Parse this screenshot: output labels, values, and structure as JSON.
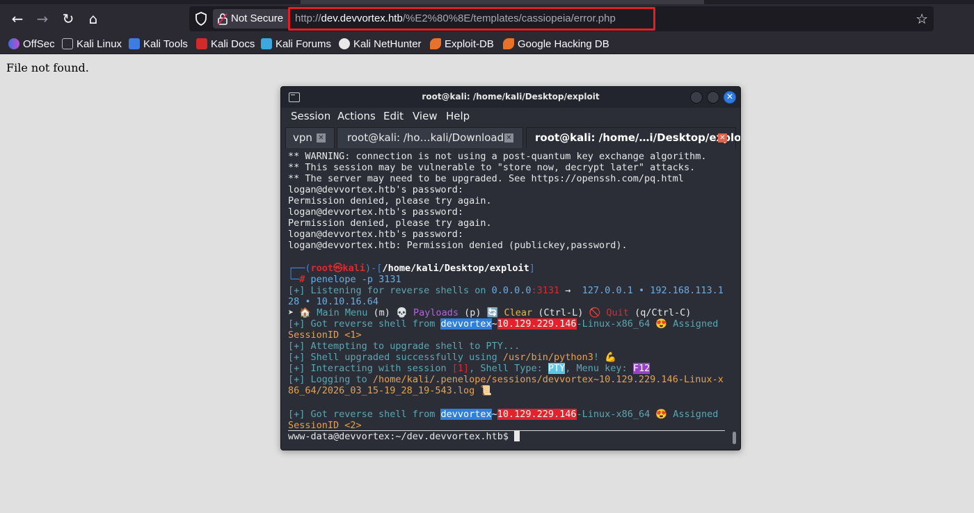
{
  "browser": {
    "not_secure_label": "Not Secure",
    "url_scheme": "http://",
    "url_host": "dev.devvortex.htb",
    "url_path": "/%E2%80%8E/templates/cassiopeia/error.php",
    "highlight_color": "#e41e25"
  },
  "bookmarks": [
    {
      "label": "OffSec",
      "icon": "offsec-icon"
    },
    {
      "label": "Kali Linux",
      "icon": "kali-dragon-icon"
    },
    {
      "label": "Kali Tools",
      "icon": "kali-tools-icon"
    },
    {
      "label": "Kali Docs",
      "icon": "kali-docs-icon"
    },
    {
      "label": "Kali Forums",
      "icon": "kali-forums-icon"
    },
    {
      "label": "Kali NetHunter",
      "icon": "nethunter-icon"
    },
    {
      "label": "Exploit-DB",
      "icon": "exploit-db-icon"
    },
    {
      "label": "Google Hacking DB",
      "icon": "ghdb-icon"
    }
  ],
  "page": {
    "message": "File not found."
  },
  "terminal": {
    "title": "root@kali: /home/kali/Desktop/exploit",
    "menu": [
      "Session",
      "Actions",
      "Edit",
      "View",
      "Help"
    ],
    "tabs": [
      {
        "label": "vpn",
        "active": false
      },
      {
        "label": "root@kali: /ho…kali/Downloads",
        "active": false
      },
      {
        "label": "root@kali: /home/…i/Desktop/exploit",
        "active": true
      }
    ],
    "lines": {
      "l1": "** WARNING: connection is not using a post-quantum key exchange algorithm.",
      "l2": "** This session may be vulnerable to \"store now, decrypt later\" attacks.",
      "l3": "** The server may need to be upgraded. See https://openssh.com/pq.html",
      "l4": "logan@devvortex.htb's password:",
      "l5": "Permission denied, please try again.",
      "l6": "logan@devvortex.htb's password:",
      "l7": "Permission denied, please try again.",
      "l8": "logan@devvortex.htb's password:",
      "l9": "logan@devvortex.htb: Permission denied (publickey,password)."
    },
    "prompt": {
      "user": "root",
      "skull": "㉿",
      "host": "kali",
      "path": "/home/kali/Desktop/exploit",
      "command": "penelope -p 3131"
    },
    "listening": {
      "prefix": "[+] Listening for reverse shells on ",
      "bind_ip": "0.0.0.0",
      "port": ":3131",
      "arrow": " → ",
      "ips_a": " 127.0.0.1 • 192.168.113.1",
      "ips_b": "28 • 10.10.16.64"
    },
    "menuline": {
      "arrow": "➤ ",
      "main_menu": " Main Menu",
      "main_key": " (m) ",
      "payloads": " Payloads",
      "payloads_key": " (p) ",
      "clear": " Clear",
      "clear_key": " (Ctrl-L) ",
      "quit": " Quit",
      "quit_key": " (q/Ctrl-C)"
    },
    "shell1": {
      "prefix": "[+] Got reverse shell from ",
      "host": "devvortex",
      "tilde": "~",
      "ip": "10.129.229.146",
      "os": "-Linux-x86_64",
      "assigned": " Assigned",
      "session": "SessionID <1>"
    },
    "attempt": "[+] Attempting to upgrade shell to PTY...",
    "upgraded": {
      "prefix": "[+] Shell upgraded successfully using ",
      "path": "/usr/bin/python3",
      "suffix": "! 💪"
    },
    "interacting": {
      "prefix": "[+] Interacting with session ",
      "num": "[1]",
      "mid": ", Shell Type: ",
      "type": "PTY",
      "mid2": ", Menu key: ",
      "key": "F12"
    },
    "logging": {
      "prefix": "[+] Logging to ",
      "path_a": "/home/kali/.penelope/sessions/devvortex~10.129.229.146-Linux-x",
      "path_b": "86_64/2026_03_15-19_28_19-543.log",
      "icon": " 📜"
    },
    "shell2": {
      "prefix": "[+] Got reverse shell from ",
      "host": "devvortex",
      "tilde": "~",
      "ip": "10.129.229.146",
      "os": "-Linux-x86_64",
      "assigned": " Assigned",
      "session": "SessionID <2>"
    },
    "final_prompt": "www-data@devvortex:~/dev.devvortex.htb$ "
  }
}
